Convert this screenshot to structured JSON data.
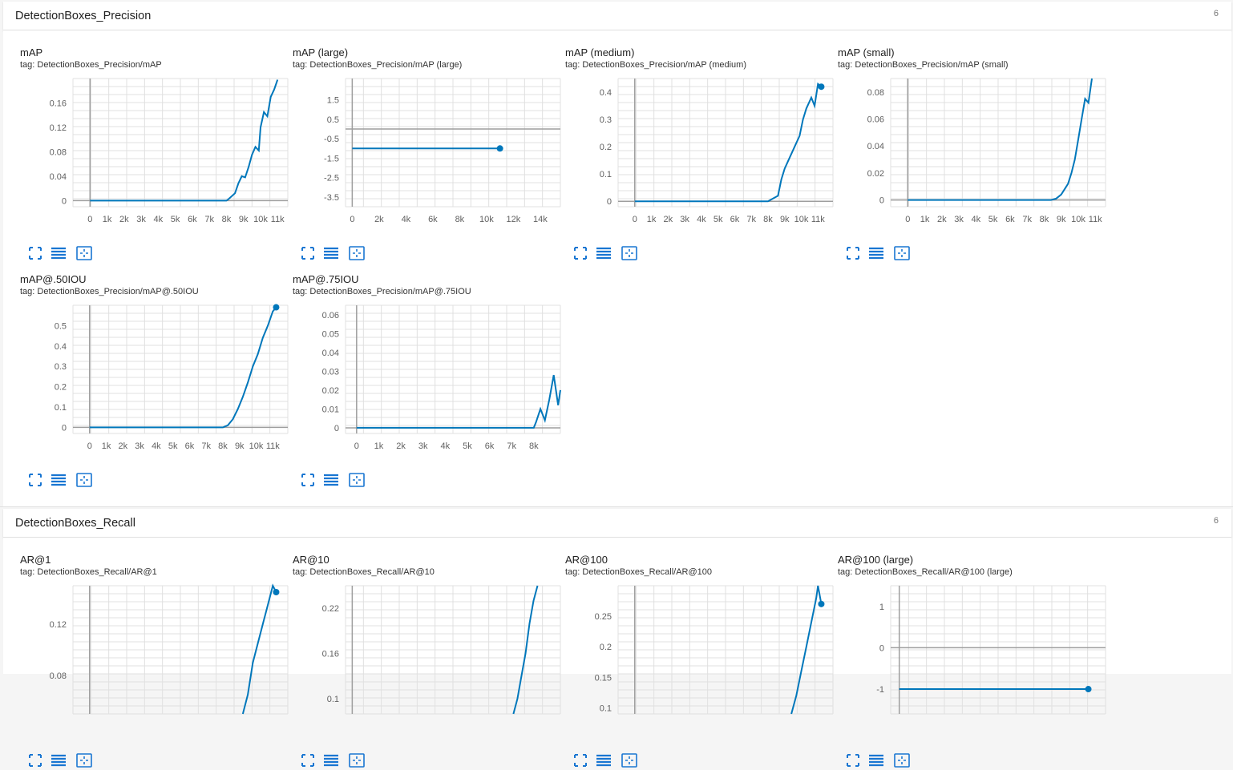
{
  "sections": [
    {
      "title": "DetectionBoxes_Precision",
      "count": "6"
    },
    {
      "title": "DetectionBoxes_Recall",
      "count": "6"
    }
  ],
  "colors": {
    "line": "#0077bb",
    "grid": "#e0e0e0",
    "axis": "#9e9e9e",
    "button": "#1976d2"
  },
  "buttons": [
    "fullscreen-icon",
    "toggle-log-scale-icon",
    "fit-domain-icon"
  ],
  "cards": [
    {
      "title": "mAP",
      "tag": "tag: DetectionBoxes_Precision/mAP",
      "chart_data": {
        "type": "line",
        "xticks": [
          "0",
          "1k",
          "2k",
          "3k",
          "4k",
          "5k",
          "6k",
          "7k",
          "8k",
          "9k",
          "10k",
          "11k"
        ],
        "xlim": [
          -1000,
          11600
        ],
        "yticks": [
          "0",
          "0.04",
          "0.08",
          "0.12",
          "0.16"
        ],
        "ytick_values": [
          0,
          0.04,
          0.08,
          0.12,
          0.16
        ],
        "ylim": [
          -0.01,
          0.2
        ],
        "grid": true,
        "series": [
          {
            "x": [
              0,
              8000,
              8100,
              8500,
              8700,
              8900,
              9100,
              9300,
              9500,
              9700,
              9900,
              10000,
              10200,
              10400,
              10600,
              10800,
              11000
            ],
            "y": [
              0,
              0,
              0.002,
              0.012,
              0.028,
              0.04,
              0.038,
              0.055,
              0.075,
              0.088,
              0.082,
              0.12,
              0.145,
              0.138,
              0.17,
              0.182,
              0.198
            ]
          }
        ]
      }
    },
    {
      "title": "mAP (large)",
      "tag": "tag: DetectionBoxes_Precision/mAP (large)",
      "chart_data": {
        "type": "line",
        "xticks": [
          "0",
          "2k",
          "4k",
          "6k",
          "8k",
          "10k",
          "12k",
          "14k"
        ],
        "xlim": [
          -500,
          15500
        ],
        "yticks": [
          "1.5",
          "0.5",
          "-0.5",
          "-1.5",
          "-2.5",
          "-3.5"
        ],
        "ytick_values": [
          1.5,
          0.5,
          -0.5,
          -1.5,
          -2.5,
          -3.5
        ],
        "ylim": [
          -4,
          2.6
        ],
        "grid": true,
        "series": [
          {
            "x": [
              0,
              11000
            ],
            "y": [
              -1,
              -1
            ],
            "endpoint": true
          }
        ]
      }
    },
    {
      "title": "mAP (medium)",
      "tag": "tag: DetectionBoxes_Precision/mAP (medium)",
      "chart_data": {
        "type": "line",
        "xticks": [
          "0",
          "1k",
          "2k",
          "3k",
          "4k",
          "5k",
          "6k",
          "7k",
          "8k",
          "9k",
          "10k",
          "11k"
        ],
        "xlim": [
          -1000,
          11900
        ],
        "yticks": [
          "0",
          "0.1",
          "0.2",
          "0.3",
          "0.4"
        ],
        "ytick_values": [
          0,
          0.1,
          0.2,
          0.3,
          0.4
        ],
        "ylim": [
          -0.02,
          0.45
        ],
        "grid": true,
        "series": [
          {
            "x": [
              0,
              8000,
              8300,
              8600,
              8800,
              9000,
              9300,
              9600,
              9900,
              10100,
              10300,
              10600,
              10800,
              11000,
              11200
            ],
            "y": [
              0,
              0,
              0.01,
              0.02,
              0.08,
              0.12,
              0.16,
              0.2,
              0.24,
              0.3,
              0.34,
              0.38,
              0.35,
              0.43,
              0.42
            ],
            "endpoint": true
          }
        ]
      }
    },
    {
      "title": "mAP (small)",
      "tag": "tag: DetectionBoxes_Precision/mAP (small)",
      "chart_data": {
        "type": "line",
        "xticks": [
          "0",
          "1k",
          "2k",
          "3k",
          "4k",
          "5k",
          "6k",
          "7k",
          "8k",
          "9k",
          "10k",
          "11k"
        ],
        "xlim": [
          -1000,
          11600
        ],
        "yticks": [
          "0",
          "0.02",
          "0.04",
          "0.06",
          "0.08"
        ],
        "ytick_values": [
          0,
          0.02,
          0.04,
          0.06,
          0.08
        ],
        "ylim": [
          -0.005,
          0.09
        ],
        "grid": true,
        "series": [
          {
            "x": [
              0,
              8400,
              8700,
              9000,
              9200,
              9400,
              9600,
              9800,
              10000,
              10200,
              10400,
              10600,
              10800
            ],
            "y": [
              0,
              0,
              0.001,
              0.004,
              0.008,
              0.012,
              0.02,
              0.03,
              0.045,
              0.06,
              0.075,
              0.072,
              0.09
            ]
          }
        ]
      }
    },
    {
      "title": "mAP@.50IOU",
      "tag": "tag: DetectionBoxes_Precision/mAP@.50IOU",
      "chart_data": {
        "type": "line",
        "xticks": [
          "0",
          "1k",
          "2k",
          "3k",
          "4k",
          "5k",
          "6k",
          "7k",
          "8k",
          "9k",
          "10k",
          "11k"
        ],
        "xlim": [
          -1000,
          11900
        ],
        "yticks": [
          "0",
          "0.1",
          "0.2",
          "0.3",
          "0.4",
          "0.5"
        ],
        "ytick_values": [
          0,
          0.1,
          0.2,
          0.3,
          0.4,
          0.5
        ],
        "ylim": [
          -0.03,
          0.6
        ],
        "grid": true,
        "series": [
          {
            "x": [
              0,
              8000,
              8300,
              8600,
              8900,
              9200,
              9500,
              9800,
              10100,
              10400,
              10700,
              11000,
              11200
            ],
            "y": [
              0,
              0,
              0.01,
              0.04,
              0.09,
              0.15,
              0.22,
              0.3,
              0.36,
              0.44,
              0.5,
              0.57,
              0.59
            ],
            "endpoint": true
          }
        ]
      }
    },
    {
      "title": "mAP@.75IOU",
      "tag": "tag: DetectionBoxes_Precision/mAP@.75IOU",
      "chart_data": {
        "type": "line",
        "xticks": [
          "0",
          "1k",
          "2k",
          "3k",
          "4k",
          "5k",
          "6k",
          "7k",
          "8k"
        ],
        "xlim": [
          -500,
          9200
        ],
        "yticks": [
          "0",
          "0.01",
          "0.02",
          "0.03",
          "0.04",
          "0.05",
          "0.06"
        ],
        "ytick_values": [
          0,
          0.01,
          0.02,
          0.03,
          0.04,
          0.05,
          0.06
        ],
        "ylim": [
          -0.003,
          0.065
        ],
        "grid": true,
        "series": [
          {
            "x": [
              0,
              8000,
              8100,
              8300,
              8500,
              8700,
              8900,
              9100,
              9200
            ],
            "y": [
              0,
              0,
              0.003,
              0.01,
              0.004,
              0.015,
              0.028,
              0.012,
              0.02
            ]
          }
        ]
      }
    },
    {
      "title": "AR@1",
      "tag": "tag: DetectionBoxes_Recall/AR@1",
      "chart_data": {
        "type": "line",
        "xticks": [],
        "xlim": [
          -1000,
          11900
        ],
        "yticks": [
          "0.08",
          "0.12"
        ],
        "ytick_values": [
          0.08,
          0.12
        ],
        "ylim": [
          0.05,
          0.15
        ],
        "grid": true,
        "series": [
          {
            "x": [
              9200,
              9500,
              9800,
              10100,
              10400,
              10700,
              11000,
              11200
            ],
            "y": [
              0.05,
              0.065,
              0.09,
              0.105,
              0.12,
              0.135,
              0.15,
              0.145
            ],
            "endpoint": true
          }
        ]
      }
    },
    {
      "title": "AR@10",
      "tag": "tag: DetectionBoxes_Recall/AR@10",
      "chart_data": {
        "type": "line",
        "xticks": [],
        "xlim": [
          -500,
          15500
        ],
        "yticks": [
          "0.1",
          "0.16",
          "0.22"
        ],
        "ytick_values": [
          0.1,
          0.16,
          0.22
        ],
        "ylim": [
          0.08,
          0.25
        ],
        "grid": true,
        "series": [
          {
            "x": [
              12000,
              12300,
              12600,
              12900,
              13200,
              13500,
              13800
            ],
            "y": [
              0.08,
              0.1,
              0.13,
              0.16,
              0.2,
              0.23,
              0.25
            ]
          }
        ]
      }
    },
    {
      "title": "AR@100",
      "tag": "tag: DetectionBoxes_Recall/AR@100",
      "chart_data": {
        "type": "line",
        "xticks": [],
        "xlim": [
          -1000,
          11900
        ],
        "yticks": [
          "0.1",
          "0.15",
          "0.2",
          "0.25"
        ],
        "ytick_values": [
          0.1,
          0.15,
          0.2,
          0.25
        ],
        "ylim": [
          0.09,
          0.3
        ],
        "grid": true,
        "series": [
          {
            "x": [
              9400,
              9700,
              10000,
              10300,
              10600,
              10900,
              11000,
              11200
            ],
            "y": [
              0.09,
              0.12,
              0.16,
              0.2,
              0.24,
              0.28,
              0.3,
              0.27
            ],
            "endpoint": true
          }
        ]
      }
    },
    {
      "title": "AR@100 (large)",
      "tag": "tag: DetectionBoxes_Recall/AR@100 (large)",
      "chart_data": {
        "type": "line",
        "xticks": [],
        "xlim": [
          -500,
          12000
        ],
        "yticks": [
          "1",
          "0",
          "-1"
        ],
        "ytick_values": [
          1,
          0,
          -1
        ],
        "ylim": [
          -1.6,
          1.5
        ],
        "grid": true,
        "series": [
          {
            "x": [
              0,
              11000
            ],
            "y": [
              -1,
              -1
            ],
            "endpoint": true
          }
        ]
      }
    }
  ]
}
